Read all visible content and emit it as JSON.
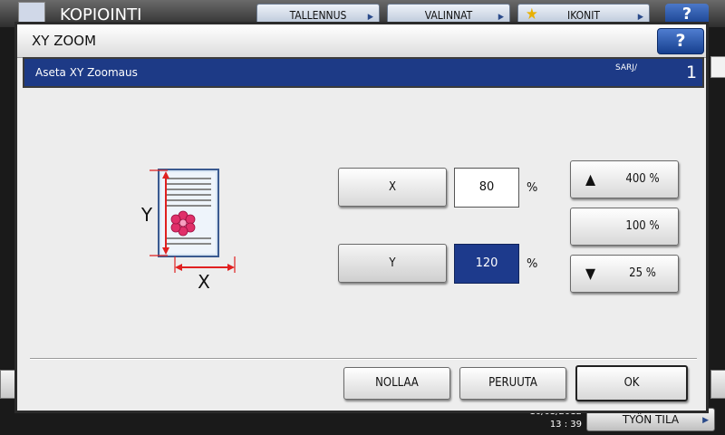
{
  "background_app": {
    "title": "KOPIOINTI",
    "tabs": [
      {
        "label": "TALLENNUS"
      },
      {
        "label": "VALINNAT"
      },
      {
        "label": "IKONIT"
      }
    ],
    "help_label": "?",
    "datetime_date": "10/03/2012",
    "datetime_time": "13 : 39",
    "job_status_label": "TYÖN TILA"
  },
  "dialog": {
    "title": "XY ZOOM",
    "help_label": "?",
    "subtitle": "Aseta XY Zoomaus",
    "sets_label": "SARJ/",
    "sets_count": "1",
    "illustration": {
      "y_label": "Y",
      "x_label": "X"
    },
    "x_button": "X",
    "x_value": "80",
    "x_unit": "%",
    "y_button": "Y",
    "y_value": "120",
    "y_unit": "%",
    "presets": [
      {
        "label": "400 %",
        "icon": "triangle-up-icon"
      },
      {
        "label": "100 %",
        "icon": ""
      },
      {
        "label": "25 %",
        "icon": "triangle-down-icon"
      }
    ],
    "reset_label": "NOLLAA",
    "cancel_label": "PERUUTA",
    "ok_label": "OK"
  },
  "colors": {
    "accent_bar": "#1d3a86",
    "selected_value": "#1d3a8c",
    "help_button": "#2a5ab0",
    "illustration_red": "#e02020",
    "flower": "#e0306a"
  }
}
